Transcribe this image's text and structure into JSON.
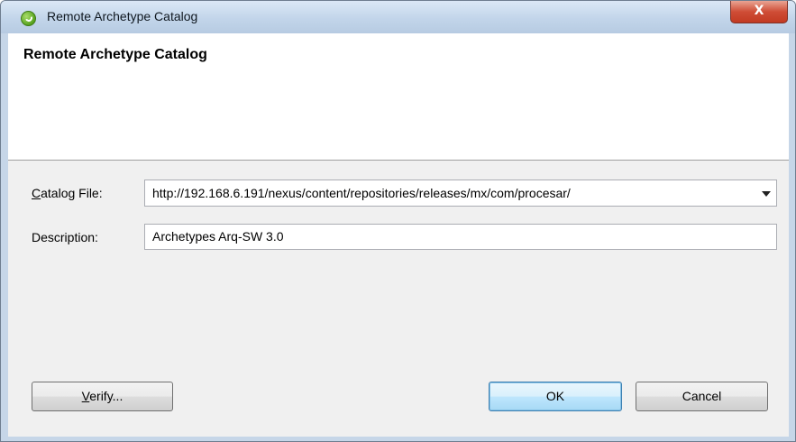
{
  "window": {
    "title": "Remote Archetype Catalog"
  },
  "titlebar": {
    "close_glyph": "X"
  },
  "header": {
    "title": "Remote Archetype Catalog"
  },
  "form": {
    "catalog_label_mnemonic": "C",
    "catalog_label_rest": "atalog File:",
    "catalog_value": "http://192.168.6.191/nexus/content/repositories/releases/mx/com/procesar/",
    "description_label": "Description:",
    "description_value": "Archetypes Arq-SW 3.0"
  },
  "buttons": {
    "verify_mnemonic": "V",
    "verify_rest": "erify...",
    "ok_label": "OK",
    "cancel_label": "Cancel"
  },
  "icons": [
    "spring-leaf-icon",
    "close-icon",
    "dropdown-arrow-icon"
  ]
}
